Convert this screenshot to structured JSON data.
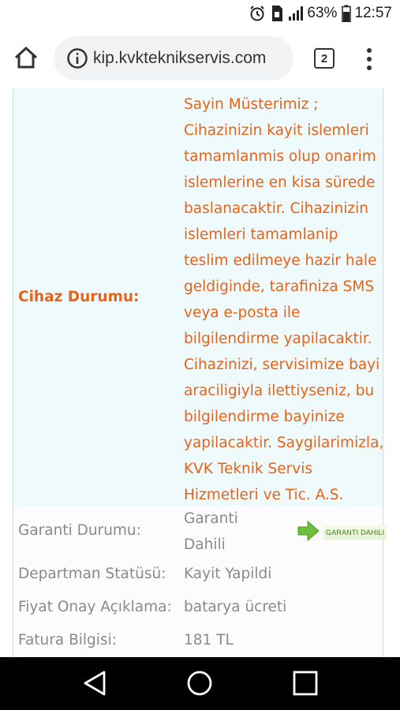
{
  "status_bar": {
    "battery": "63%",
    "time": "12:57"
  },
  "browser": {
    "url": "kip.kvkteknikservis.com",
    "tab_count": "2"
  },
  "service_info": {
    "cihaz_durumu": {
      "label": "Cihaz Durumu:",
      "message_lines": [
        "Sayin Müsterimiz ;",
        "Cihazinizin kayit islemleri",
        "tamamlanmis olup onarim",
        "islemlerine en kisa sürede",
        "baslanacaktir. Cihazinizin",
        "islemleri tamamlanip",
        "teslim edilmeye hazir hale",
        "geldiginde, tarafiniza SMS",
        "veya e-posta ile",
        "bilgilendirme yapilacaktir.",
        "Cihazinizi, servisimize bayi",
        "araciligiyla ilettiyseniz, bu",
        "bilgilendirme bayinize",
        "yapilacaktir. Saygilarimizla,",
        "KVK Teknik Servis",
        "Hizmetleri ve Tic. A.S."
      ]
    },
    "garanti_durumu": {
      "label": "Garanti Durumu:",
      "value_line1": "Garanti",
      "value_line2": "Dahili",
      "badge": "GARANTI DAHILI"
    },
    "departman_statusu": {
      "label": "Departman Statüsü:",
      "value": "Kayit Yapildi"
    },
    "fiyat_onay": {
      "label": "Fiyat Onay Açıklama:",
      "value": "batarya ücreti"
    },
    "fatura_bilgisi": {
      "label": "Fatura Bilgisi:",
      "value": "181 TL"
    }
  },
  "colors": {
    "accent_orange": "#e8631a",
    "label_gray": "#8a8a8a",
    "status_row_bg": "#eefafb",
    "badge_green": "#6cbf3a"
  },
  "icons": {
    "status_bar": [
      "alarm-icon",
      "sim-icon",
      "signal-icon",
      "battery-icon"
    ],
    "browser": [
      "home-icon",
      "info-icon",
      "tabs-icon",
      "menu-icon"
    ],
    "nav": [
      "back-icon",
      "home-circle-icon",
      "recents-icon"
    ]
  }
}
